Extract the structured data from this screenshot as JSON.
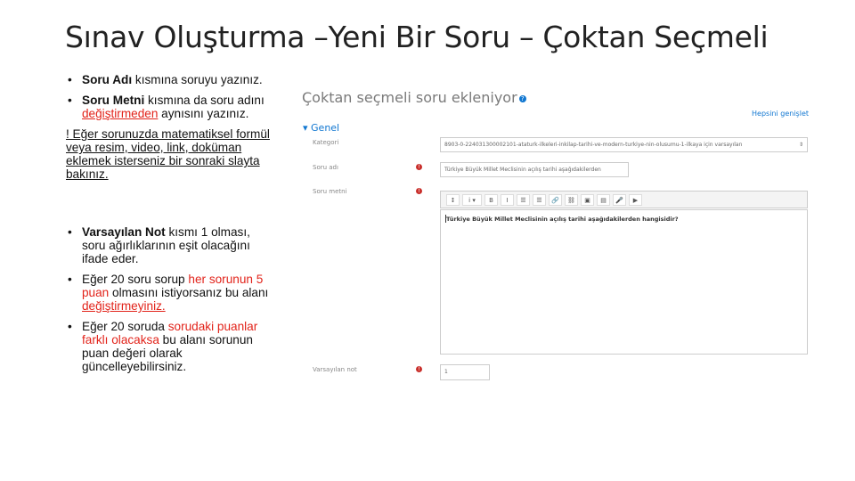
{
  "slide": {
    "title": "Sınav Oluşturma –Yeni Bir Soru – Çoktan Seçmeli"
  },
  "notes": {
    "bullet_char": "•",
    "b1": {
      "bold": "Soru Adı",
      "text": " kısmına soruyu yazınız."
    },
    "b2": {
      "bold": "Soru Metni",
      "t1": " kısmına da soru adını ",
      "red": "değiştirmeden",
      "t2": " aynısını yazınız."
    },
    "warning": "! Eğer sorunuzda matematiksel formül veya resim, video, link, doküman eklemek isterseniz bir sonraki slayta bakınız.",
    "b3": {
      "bold": "Varsayılan Not",
      "text": " kısmı 1 olması, soru ağırlıklarının eşit olacağını ifade eder."
    },
    "b4": {
      "t1": "Eğer 20 soru sorup ",
      "red": "her sorunun 5 puan",
      "t2": " olmasını istiyorsanız bu alanı ",
      "red_u": "değiştirmeyiniz."
    },
    "b5": {
      "t1": "Eğer 20 soruda ",
      "red": "sorudaki puanlar farklı olacaksa",
      "t2": " bu alanı sorunun puan değeri olarak güncelleyebilirsiniz."
    }
  },
  "screenshot": {
    "heading": "Çoktan seçmeli soru ekleniyor",
    "help_icon": "question-circle-icon",
    "expand_all": "Hepsini genişlet",
    "section": "Genel",
    "category_label": "Kategori",
    "category_value": "8903-0-224031300002101-ataturk-ilkeleri-inkilap-tarihi-ve-modern-turkiye-nin-olusumu-1-ilkaya için varsayılan",
    "name_label": "Soru adı",
    "name_value": "Türkiye Büyük Millet Meclisinin açılış tarihi aşağıdakilerden",
    "text_label": "Soru metni",
    "editor_text": "Türkiye Büyük Millet Meclisinin açılış tarihi aşağıdakilerden hangisidir?",
    "toolbar": [
      "↕",
      "i ▾",
      "B",
      "I",
      "☰",
      "☰",
      "🔗",
      "⛓",
      "▣",
      "▤",
      "🎤",
      "▶"
    ],
    "mark_label": "Varsayılan not",
    "mark_value": "1",
    "required_symbol": "!",
    "select_arrow": "⇕"
  }
}
